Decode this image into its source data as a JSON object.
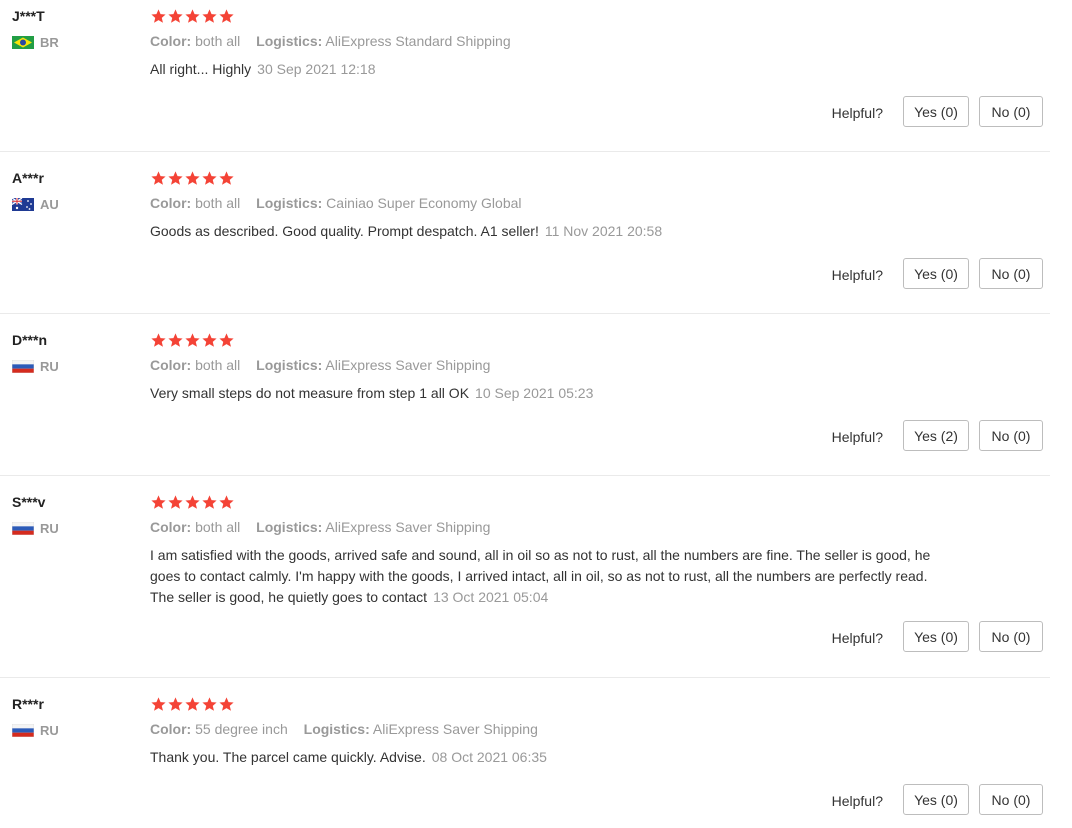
{
  "helpful_label": "Helpful?",
  "color_key": "Color:",
  "logistics_key": "Logistics:",
  "star_color": "#f44336",
  "reviews": [
    {
      "name": "J***T",
      "country": "BR",
      "flag": "brazil-flag",
      "rating": 5,
      "color": "both all",
      "logistics": "AliExpress Standard Shipping",
      "text": "All right... Highly",
      "date": "30 Sep 2021 12:18",
      "yes": "Yes (0)",
      "no": "No (0)"
    },
    {
      "name": "A***r",
      "country": "AU",
      "flag": "australia-flag",
      "rating": 5,
      "color": "both all",
      "logistics": "Cainiao Super Economy Global",
      "text": "Goods as described. Good quality. Prompt despatch. A1 seller!",
      "date": "11 Nov 2021 20:58",
      "yes": "Yes (0)",
      "no": "No (0)"
    },
    {
      "name": "D***n",
      "country": "RU",
      "flag": "russia-flag",
      "rating": 5,
      "color": "both all",
      "logistics": "AliExpress Saver Shipping",
      "text": "Very small steps do not measure from step 1 all OK",
      "date": "10 Sep 2021 05:23",
      "yes": "Yes (2)",
      "no": "No (0)"
    },
    {
      "name": "S***v",
      "country": "RU",
      "flag": "russia-flag",
      "rating": 5,
      "color": "both all",
      "logistics": "AliExpress Saver Shipping",
      "text": "I am satisfied with the goods, arrived safe and sound, all in oil so as not to rust, all the numbers are fine. The seller is good, he goes to contact calmly. I'm happy with the goods, I arrived intact, all in oil, so as not to rust, all the numbers are perfectly read. The seller is good, he quietly goes to contact",
      "date": "13 Oct 2021 05:04",
      "yes": "Yes (0)",
      "no": "No (0)"
    },
    {
      "name": "R***r",
      "country": "RU",
      "flag": "russia-flag",
      "rating": 5,
      "color": "55 degree inch",
      "logistics": "AliExpress Saver Shipping",
      "text": "Thank you. The parcel came quickly. Advise.",
      "date": "08 Oct 2021 06:35",
      "yes": "Yes (0)",
      "no": "No (0)"
    }
  ]
}
